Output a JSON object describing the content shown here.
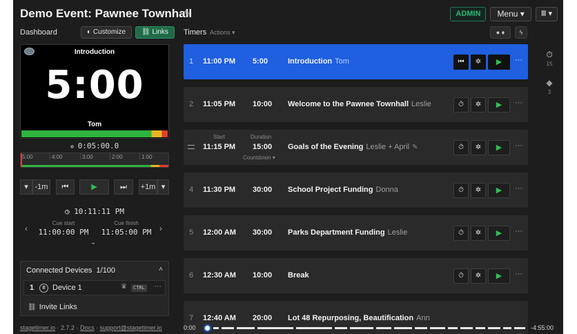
{
  "header": {
    "title": "Demo Event: Pawnee Townhall",
    "admin_label": "ADMIN",
    "menu_label": "Menu ▾",
    "view_label": "▾"
  },
  "left": {
    "dashboard_label": "Dashboard",
    "customize_label": "Customize",
    "links_label": "Links",
    "preview": {
      "title": "Introduction",
      "time": "5:00",
      "speaker": "Tom"
    },
    "elapsed": "0:05:00.0",
    "scrub_ticks": [
      "5:00",
      "4:00",
      "3:00",
      "2:00",
      "1:00"
    ],
    "controls": {
      "minus_label": "-1m",
      "plus_label": "+1m"
    },
    "clock": "10:11:11 PM",
    "cue_start_label": "Cue start",
    "cue_start_value": "11:00:00 PM",
    "cue_finish_label": "Cue finish",
    "cue_finish_value": "11:05:00 PM",
    "devices": {
      "title": "Connected Devices",
      "count": "1/100",
      "device_number": "1",
      "device_name": "Device 1",
      "ctrl_badge": "CTRL",
      "invite_label": "Invite Links"
    },
    "footer": {
      "site": "stagetimer.io",
      "version": "· 2.7.2 ·",
      "docs": "Docs",
      "sep": "·",
      "email": "support@stagetimer.io"
    }
  },
  "timers": {
    "label": "Timers",
    "actions_label": "Actions ▾",
    "start_label": "Start",
    "duration_label": "Duration",
    "countdown_label": "Countdown ▾",
    "rows": [
      {
        "num": "1",
        "start": "11:00 PM",
        "duration": "5:00",
        "title": "Introduction",
        "speaker": "Tom"
      },
      {
        "num": "2",
        "start": "11:05 PM",
        "duration": "10:00",
        "title": "Welcome to the Pawnee Townhall",
        "speaker": "Leslie"
      },
      {
        "num": "3",
        "start": "11:15 PM",
        "duration": "15:00",
        "title": "Goals of the Evening",
        "speaker": "Leslie + April"
      },
      {
        "num": "4",
        "start": "11:30 PM",
        "duration": "30:00",
        "title": "School Project Funding",
        "speaker": "Donna"
      },
      {
        "num": "5",
        "start": "12:00 AM",
        "duration": "30:00",
        "title": "Parks Department Funding",
        "speaker": "Leslie"
      },
      {
        "num": "6",
        "start": "12:30 AM",
        "duration": "10:00",
        "title": "Break",
        "speaker": ""
      },
      {
        "num": "7",
        "start": "12:40 AM",
        "duration": "20:00",
        "title": "Lot 48 Repurposing, Beautification",
        "speaker": "Ann"
      }
    ]
  },
  "rail": {
    "timers_count": "15",
    "messages_count": "3"
  },
  "timeline": {
    "start": "0:00",
    "end": "-4:55:00"
  }
}
